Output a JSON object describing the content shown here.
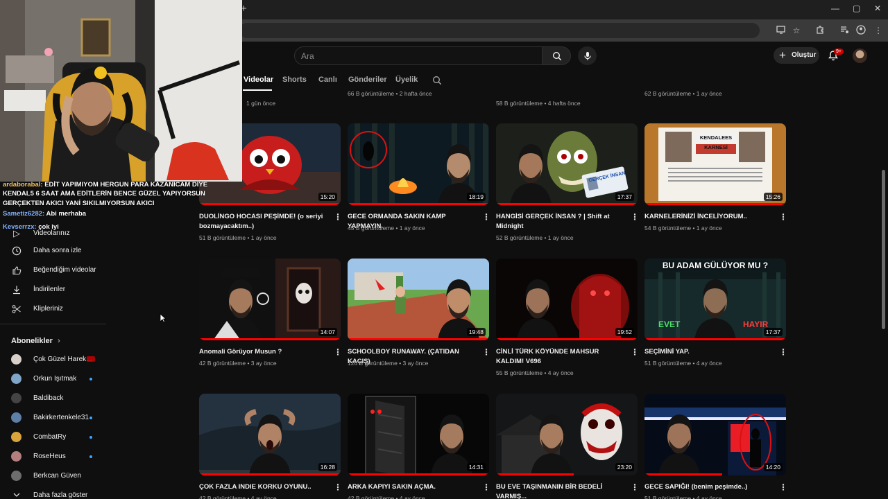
{
  "browser": {
    "newtab_glyph": "+",
    "window_controls": [
      "—",
      "▢",
      "✕"
    ]
  },
  "header": {
    "search_placeholder": "Ara",
    "create_label": "Oluştur",
    "notifications_badge": "9+"
  },
  "channel_tabs": [
    {
      "label": "Videolar",
      "active": true
    },
    {
      "label": "Shorts",
      "active": false
    },
    {
      "label": "Canlı",
      "active": false
    },
    {
      "label": "Gönderiler",
      "active": false
    },
    {
      "label": "Üyelik",
      "active": false
    }
  ],
  "chat": [
    {
      "user": "ardaborabal",
      "text": "EDİT YAPIMIYOM HERGUN PARA KAZANICAM DİYE KENDAL5 6 SAAT AMA EDİTLERİN BENCE GÜZEL YAPIYORSUN GERÇEKTEN AKICI YANİ SIKILMIYORSUN AKICI"
    },
    {
      "user": "Sametiz6282",
      "text": "Abi merhaba"
    },
    {
      "user": "Kevserrzx",
      "text": "çok iyi"
    }
  ],
  "sidebar": {
    "partial_label": "Videolarınız",
    "items": [
      {
        "label": "Daha sonra izle",
        "icon": "clock-icon"
      },
      {
        "label": "Beğendiğim videolar",
        "icon": "thumbs-up-icon"
      },
      {
        "label": "İndirilenler",
        "icon": "download-icon"
      },
      {
        "label": "Klipleriniz",
        "icon": "scissors-icon"
      }
    ],
    "subscriptions_title": "Abonelikler",
    "subscriptions": [
      {
        "name": "Çok Güzel Harek...",
        "indicator": "live",
        "color": "#d8d0c8"
      },
      {
        "name": "Orkun Işıtmak",
        "indicator": "dot",
        "color": "#7fa6c9"
      },
      {
        "name": "Baldiback",
        "indicator": "none",
        "color": "#444444"
      },
      {
        "name": "Bakirkertenkele31",
        "indicator": "dot",
        "color": "#5e7fa8"
      },
      {
        "name": "CombatRy",
        "indicator": "dot",
        "color": "#d9a43c"
      },
      {
        "name": "RoseHeus",
        "indicator": "dot",
        "color": "#b57e7e"
      },
      {
        "name": "Berkcan Güven",
        "indicator": "none",
        "color": "#6d6d6d"
      }
    ],
    "show_more": "Daha fazla göster"
  },
  "partial_row": [
    {
      "meta": "1 gün önce"
    },
    {
      "meta": "66 B görüntüleme • 2 hafta önce"
    },
    {
      "meta": "58 B görüntüleme • 4 hafta önce"
    },
    {
      "meta": "62 B görüntüleme • 1 ay önce"
    }
  ],
  "videos": [
    {
      "title": "DUOLİNGO HOCASI PEŞİMDE! (o seriyi bozmayacaktım..)",
      "meta": "51 B görüntüleme • 1 ay önce",
      "duration": "15:20",
      "progress": 1.0,
      "theme": "owl"
    },
    {
      "title": "GECE ORMANDA SAKIN KAMP YAPMAYIN.",
      "meta": "45 B görüntüleme • 1 ay önce",
      "duration": "18:19",
      "progress": 1.0,
      "theme": "forest"
    },
    {
      "title": "HANGİSİ GERÇEK İNSAN ? | Shift at Midnight",
      "meta": "52 B görüntüleme • 1 ay önce",
      "duration": "17:37",
      "progress": 1.0,
      "theme": "monster",
      "overlay": "GERÇEK İNSAN"
    },
    {
      "title": "KARNELERİNİZİ İNCELİYORUM..",
      "meta": "54 B görüntüleme • 1 ay önce",
      "duration": "15:26",
      "progress": 1.0,
      "theme": "report",
      "overlay": "KENDALEES KARNESİ"
    },
    {
      "title": "Anomali Görüyor Musun ?",
      "meta": "42 B görüntüleme • 3 ay önce",
      "duration": "14:07",
      "progress": 1.0,
      "theme": "detective"
    },
    {
      "title": "SCHOOLBOY RUNAWAY. (ÇATIDAN KAÇIŞ)",
      "meta": "126 B görüntüleme • 3 ay önce",
      "duration": "19:48",
      "progress": 1.0,
      "theme": "schoolboy"
    },
    {
      "title": "CİNLİ TÜRK KÖYÜNDE MAHSUR KALDIM! V696",
      "meta": "55 B görüntüleme • 4 ay önce",
      "duration": "19:52",
      "progress": 1.0,
      "theme": "red"
    },
    {
      "title": "SEÇİMİNİ YAP.",
      "meta": "51 B görüntüleme • 4 ay önce",
      "duration": "17:37",
      "progress": 1.0,
      "theme": "choice",
      "overlay": "BU ADAM GÜLÜYOR MU ?",
      "left_word": "EVET",
      "right_word": "HAYIR"
    },
    {
      "title": "ÇOK FAZLA INDIE KORKU OYUNU..",
      "meta": "42 B görüntüleme • 4 ay önce",
      "duration": "16:28",
      "progress": 1.0,
      "theme": "scream"
    },
    {
      "title": "ARKA KAPIYI SAKIN AÇMA.",
      "meta": "42 B görüntüleme • 4 ay önce",
      "duration": "14:31",
      "progress": 1.0,
      "theme": "door"
    },
    {
      "title": "BU EVE TAŞINMANIN BİR BEDELİ VARMIŞ...",
      "meta": "41 B görüntüleme • 4 ay önce",
      "duration": "23:20",
      "progress": 0.55,
      "theme": "clown"
    },
    {
      "title": "GECE SAPIĞI! (benim peşimde..)",
      "meta": "51 B görüntüleme • 4 ay önce",
      "duration": "14:20",
      "progress": 0.55,
      "theme": "station"
    }
  ]
}
